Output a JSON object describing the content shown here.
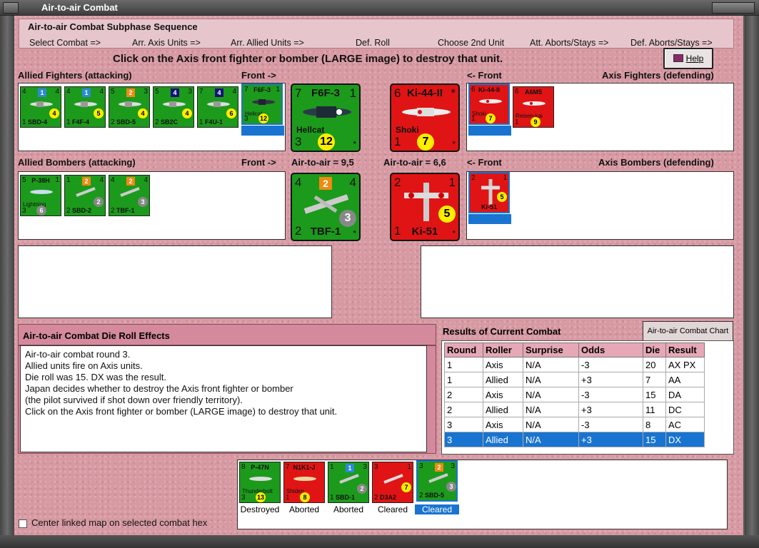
{
  "window": {
    "title": "Air-to-air Combat"
  },
  "sequence": {
    "title": "Air-to-air Combat Subphase Sequence",
    "steps": [
      "Select Combat =>",
      "Arr. Axis Units =>",
      "Arr. Allied Units =>",
      "Def. Roll",
      "Choose 2nd Unit",
      "Att. Aborts/Stays =>",
      "Def. Aborts/Stays =>"
    ]
  },
  "instruction": "Click on the Axis front fighter or bomber (LARGE image) to destroy that unit.",
  "help_label": "Help",
  "labels": {
    "allied_fighters": "Allied Fighters (attacking)",
    "front_right": "Front ->",
    "front_left": "<- Front",
    "axis_fighters": "Axis Fighters (defending)",
    "allied_bombers": "Allied Bombers (attacking)",
    "axis_bombers": "Axis Bombers (defending)",
    "a2a_allied": "Air-to-air = 9,5",
    "a2a_axis": "Air-to-air = 6,6"
  },
  "allied_fighters": [
    {
      "name": "SBD-4",
      "tl": "4",
      "tr": "4",
      "bl": "1",
      "sq": "1",
      "sqc": "blue",
      "dot": "4"
    },
    {
      "name": "F4F-4",
      "tl": "4",
      "tr": "4",
      "bl": "1",
      "sq": "1",
      "sqc": "blue",
      "dot": "5"
    },
    {
      "name": "SBD-5",
      "tl": "5",
      "tr": "3",
      "bl": "2",
      "sq": "2",
      "sqc": "orange",
      "dot": "4"
    },
    {
      "name": "SB2C",
      "tl": "5",
      "tr": "3",
      "bl": "2",
      "sq": "4",
      "sqc": "navy",
      "dot": "4"
    },
    {
      "name": "F4U-1",
      "tl": "7",
      "tr": "4",
      "bl": "1",
      "sq": "4",
      "sqc": "navy",
      "dot": "6"
    },
    {
      "name": "F6F-3",
      "tl": "7",
      "tr": "1",
      "bl": "3",
      "sub": "Hellcat",
      "dot": "12"
    }
  ],
  "allied_front_fighter": {
    "name": "F6F-3",
    "tl": "7",
    "tr": "1",
    "bl": "3",
    "br": "*",
    "sub": "Hellcat",
    "dot": "12"
  },
  "axis_front_fighter": {
    "name": "Ki-44-II",
    "tl": "6",
    "tr": "*",
    "bl": "1",
    "br": "*",
    "sub": "Shoki",
    "dot": "7"
  },
  "axis_fighters": [
    {
      "name": "Ki-44-II",
      "tl": "6",
      "bl": "1",
      "sub": "Shoki",
      "dot": "7"
    },
    {
      "name": "A6M5",
      "tl": "6",
      "bl": "1",
      "sub": "Reisen-kai",
      "dot": "9"
    }
  ],
  "allied_bombers": [
    {
      "name": "P-38H",
      "tl": "5",
      "tr": "1",
      "bl": "3",
      "sub": "Lightning",
      "dot": "6"
    },
    {
      "name": "SBD-2",
      "tl": "1",
      "tr": "4",
      "bl": "2",
      "sq": "2",
      "dot": "2"
    },
    {
      "name": "TBF-1",
      "tl": "4",
      "tr": "4",
      "bl": "2",
      "sq": "2",
      "dot": "3"
    }
  ],
  "allied_front_bomber": {
    "name": "TBF-1",
    "tl": "4",
    "tr": "4",
    "bl": "2",
    "br": "*",
    "sq": "2",
    "dot": "3"
  },
  "axis_front_bomber": {
    "name": "Ki-51",
    "tl": "2",
    "tr": "1",
    "bl": "1",
    "br": "*",
    "dot": "5"
  },
  "axis_bombers": [
    {
      "name": "Ki-51",
      "tl": "2",
      "tr": "1",
      "dot": "5"
    }
  ],
  "die_roll_effects": {
    "title": "Air-to-air Combat Die Roll Effects",
    "lines": [
      "Air-to-air combat round 3.",
      "Allied units fire on Axis units.",
      "Die roll was 15.  DX was the result.",
      "Japan decides whether to destroy the Axis front fighter or bomber",
      "(the pilot survived if shot down over friendly territory).",
      "Click on the Axis front fighter or bomber (LARGE image) to destroy that unit."
    ]
  },
  "results": {
    "title": "Results of Current Combat",
    "chart_button": "Air-to-air Combat Chart",
    "headers": [
      "Round",
      "Roller",
      "Surprise",
      "Odds",
      "Die",
      "Result"
    ],
    "rows": [
      [
        "1",
        "Axis",
        "N/A",
        "-3",
        "20",
        "AX PX"
      ],
      [
        "1",
        "Allied",
        "N/A",
        "+3",
        "7",
        "AA"
      ],
      [
        "2",
        "Axis",
        "N/A",
        "-3",
        "15",
        "DA"
      ],
      [
        "2",
        "Allied",
        "N/A",
        "+3",
        "11",
        "DC"
      ],
      [
        "3",
        "Axis",
        "N/A",
        "-3",
        "8",
        "AC"
      ],
      [
        "3",
        "Allied",
        "N/A",
        "+3",
        "15",
        "DX"
      ]
    ],
    "selected_row": 5
  },
  "status_units": [
    {
      "name": "P-47N",
      "sub": "Thunderbolt",
      "tl": "8",
      "bl": "3",
      "dot": "13",
      "color": "green",
      "status": "Destroyed"
    },
    {
      "name": "N1K1-J",
      "sub": "Shiden",
      "tl": "7",
      "bl": "1",
      "dot": "8",
      "color": "red",
      "status": "Aborted"
    },
    {
      "name": "SBD-1",
      "tl": "1",
      "tr": "3",
      "bl": "1",
      "sq": "1",
      "dot": "2",
      "color": "green",
      "status": "Aborted"
    },
    {
      "name": "D3A2",
      "tl": "3",
      "tr": "1",
      "bl": "2",
      "dot": "7",
      "color": "red",
      "status": "Cleared"
    },
    {
      "name": "SBD-5",
      "tl": "3",
      "tr": "3",
      "bl": "2",
      "sq": "2",
      "dot": "3",
      "color": "green",
      "status": "Cleared"
    }
  ],
  "checkbox_label": "Center linked map on selected combat hex",
  "colors": {
    "allied": "#1c9a1c",
    "axis": "#e01414",
    "selection": "#1874d0",
    "background": "#d79aa3"
  }
}
